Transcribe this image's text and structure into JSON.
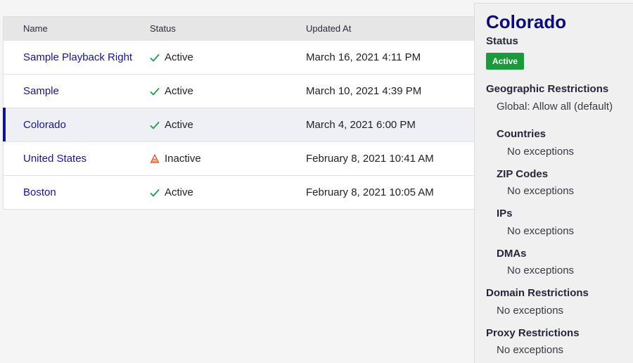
{
  "table": {
    "headers": {
      "name": "Name",
      "status": "Status",
      "updated": "Updated At"
    },
    "rows": [
      {
        "name": "Sample Playback Right",
        "status": "Active",
        "status_icon": "check-icon",
        "updated": "March 16, 2021 4:11 PM"
      },
      {
        "name": "Sample",
        "status": "Active",
        "status_icon": "check-icon",
        "updated": "March 10, 2021 4:39 PM"
      },
      {
        "name": "Colorado",
        "status": "Active",
        "status_icon": "check-icon",
        "updated": "March 4, 2021 6:00 PM",
        "selected": true
      },
      {
        "name": "United States",
        "status": "Inactive",
        "status_icon": "warning-cone-icon",
        "updated": "February 8, 2021 10:41 AM"
      },
      {
        "name": "Boston",
        "status": "Active",
        "status_icon": "check-icon",
        "updated": "February 8, 2021 10:05 AM"
      }
    ]
  },
  "panel": {
    "title": "Colorado",
    "status_label": "Status",
    "status_badge": "Active",
    "geo_label": "Geographic Restrictions",
    "geo_value": "Global: Allow all (default)",
    "countries_label": "Countries",
    "countries_value": "No exceptions",
    "zip_label": "ZIP Codes",
    "zip_value": "No exceptions",
    "ips_label": "IPs",
    "ips_value": "No exceptions",
    "dmas_label": "DMAs",
    "dmas_value": "No exceptions",
    "domain_label": "Domain Restrictions",
    "domain_value": "No exceptions",
    "proxy_label": "Proxy Restrictions",
    "proxy_value": "No exceptions"
  },
  "colors": {
    "link": "#15158f",
    "active_badge": "#1a9a3c",
    "check": "#1f9a4a",
    "warning": "#e0613a",
    "selected_bar": "#14148a"
  }
}
